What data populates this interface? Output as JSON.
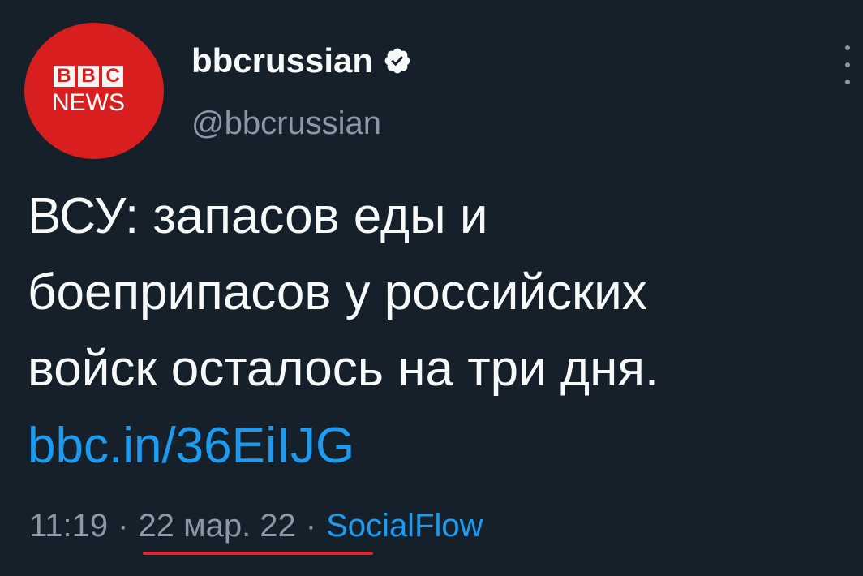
{
  "account": {
    "avatar_letters": [
      "B",
      "B",
      "C"
    ],
    "avatar_subtitle": "NEWS",
    "display_name": "bbcrussian",
    "handle": "@bbcrussian",
    "verified_icon": "verified-badge-icon"
  },
  "tweet": {
    "lines": [
      "ВСУ: запасов еды и",
      "боеприпасов у российских",
      "войск осталось на три дня."
    ],
    "link": "bbc.in/36EiIJG"
  },
  "meta": {
    "time": "11:19",
    "separator": "·",
    "date": "22 мар. 22",
    "source": "SocialFlow"
  },
  "colors": {
    "background": "#15202b",
    "accent": "#1d9bf0",
    "brand_red": "#d81e1e",
    "highlight_underline": "#e0262e"
  }
}
